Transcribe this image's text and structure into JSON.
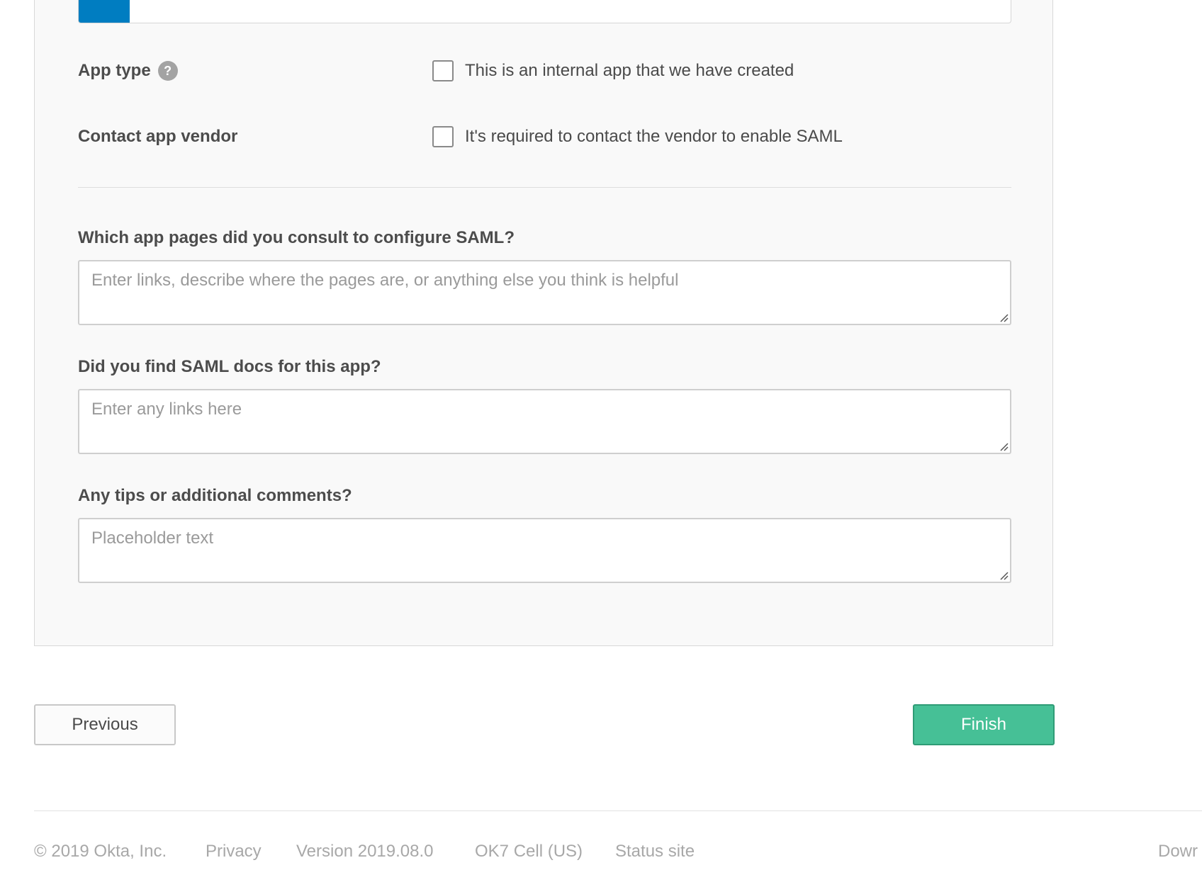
{
  "form": {
    "app_type": {
      "label": "App type",
      "help_icon": "?",
      "checkbox_label": "This is an internal app that we have created",
      "checked": false
    },
    "contact_vendor": {
      "label": "Contact app vendor",
      "checkbox_label": "It's required to contact the vendor to enable SAML",
      "checked": false
    },
    "consult_pages": {
      "label": "Which app pages did you consult to configure SAML?",
      "placeholder": "Enter links, describe where the pages are, or anything else you think is helpful",
      "value": ""
    },
    "saml_docs": {
      "label": "Did you find SAML docs for this app?",
      "placeholder": "Enter any links here",
      "value": ""
    },
    "comments": {
      "label": "Any tips or additional comments?",
      "placeholder": "Placeholder text",
      "value": ""
    }
  },
  "actions": {
    "previous_label": "Previous",
    "finish_label": "Finish"
  },
  "footer": {
    "copyright": "© 2019 Okta, Inc.",
    "privacy": "Privacy",
    "version": "Version 2019.08.0",
    "cell": "OK7 Cell (US)",
    "status": "Status site",
    "download": "Dowr"
  },
  "colors": {
    "info_accent": "#007dc1",
    "finish_button": "#46c096",
    "panel_background": "#f9f9f9"
  },
  "icons": {
    "help": "help-circle-icon",
    "info": "info-icon",
    "resize": "resize-handle-icon"
  }
}
